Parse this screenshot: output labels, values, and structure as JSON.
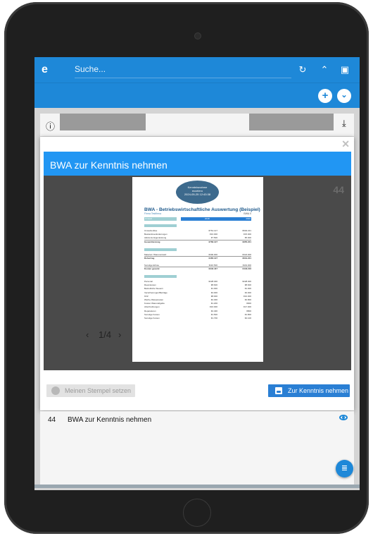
{
  "app": {
    "logo": "e",
    "search_placeholder": "Suche..."
  },
  "toolbar": {
    "refresh_icon": "refresh-icon",
    "collapse_icon": "chevron-up-icon",
    "user_icon": "account-box-icon"
  },
  "subbar": {
    "add_icon": "plus-icon",
    "menu_icon": "chevron-down-icon"
  },
  "background_row": {
    "info_icon": "info-icon",
    "download_icon": "download-icon"
  },
  "modal": {
    "close": "✕",
    "title": "BWA zur Kenntnis nehmen",
    "page_count": "44",
    "pager": {
      "prev": "‹",
      "label": "1/4",
      "next": "›"
    },
    "buttons": {
      "stamp": "Meinen Stempel setzen",
      "acknowledge": "Zur Kenntnis nehmen"
    }
  },
  "document": {
    "stamp_lines": [
      "Kenntnisnahme",
      "eccelero",
      "2024-05-25 12:43:38"
    ],
    "title": "BWA - Betriebswirtschaftliche Auswertung (Beispiel)",
    "company": "Firma Testfirma",
    "period": "BWA 0",
    "header_cols": [
      "Umsatz",
      "2018",
      "2020"
    ],
    "rows": [
      {
        "label": "Umsatzerlöse",
        "a": "€761.127",
        "b": "€940.221"
      },
      {
        "label": "Bestandsveränderungen",
        "a": "€10.000",
        "b": "€15.000"
      },
      {
        "label": "Aktivierte Eigenleistung",
        "a": "€7.500",
        "b": "€5.000"
      },
      {
        "label": "Gesamtleistung",
        "a": "€766.127",
        "b": "€955.221"
      },
      {
        "label": "Material / Wareneinsatz",
        "a": "€300.000",
        "b": "€324.000"
      },
      {
        "label": "Rohertrag",
        "a": "€465.127",
        "b": "€631.221"
      },
      {
        "label": "Sonstige Erlöse",
        "a": "€116.500",
        "b": "€119.000"
      },
      {
        "label": "Kosten gesamt",
        "a": "€343.447",
        "b": "€443.216"
      },
      {
        "label": "Personal",
        "a": "€228.300",
        "b": "€228.300"
      },
      {
        "label": "Raumkosten",
        "a": "€8.600",
        "b": "€8.600"
      },
      {
        "label": "Betriebliche Steuern",
        "a": "€1.000",
        "b": "€1.000"
      },
      {
        "label": "Versicherungen/Beiträge",
        "a": "€4.000",
        "b": "€4.000"
      },
      {
        "label": "KFZ",
        "a": "€8.000",
        "b": "€10.000"
      },
      {
        "label": "Werbe-/Reisekosten",
        "a": "€2.300",
        "b": "€2.800"
      },
      {
        "label": "Kosten Warenabgabe",
        "a": "€1.200",
        "b": "€900"
      },
      {
        "label": "Abschreibungen",
        "a": "€16.000",
        "b": "€17.000"
      },
      {
        "label": "Reparaturen",
        "a": "€2.400",
        "b": "€800"
      },
      {
        "label": "Sonstige Kosten",
        "a": "€1.500",
        "b": "€1.800"
      },
      {
        "label": "Sonstige Kosten",
        "a": "€1.700",
        "b": "€2.100"
      }
    ]
  },
  "list": {
    "rows": [
      {
        "num": "44",
        "label": "BWA zur Kenntnis nehmen"
      }
    ],
    "fab_icon": "list-icon"
  },
  "colors": {
    "primary": "#1e88d8",
    "modal_header": "#2196f3",
    "viewer_bg": "#4a4a4a"
  }
}
